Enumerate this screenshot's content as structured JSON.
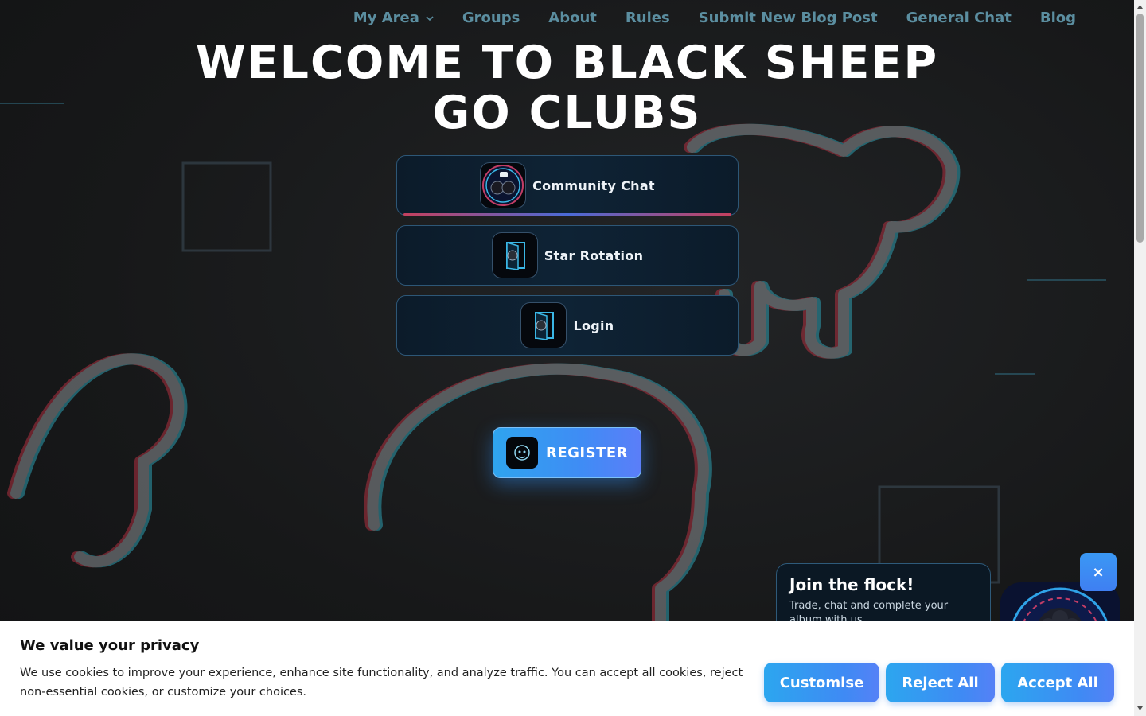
{
  "nav": {
    "items": [
      {
        "label": "My Area",
        "dropdown": true
      },
      {
        "label": "Groups"
      },
      {
        "label": "About"
      },
      {
        "label": "Rules"
      },
      {
        "label": "Submit New Blog Post"
      },
      {
        "label": "General Chat"
      },
      {
        "label": "Blog"
      }
    ]
  },
  "hero": {
    "title_line1": "WELCOME TO BLACK SHEEP",
    "title_line2": "GO CLUBS"
  },
  "actions": [
    {
      "label": "Community Chat",
      "icon": "chat-sheep-icon"
    },
    {
      "label": "Star Rotation",
      "icon": "door-sheep-icon"
    },
    {
      "label": "Login",
      "icon": "door-sheep-icon"
    }
  ],
  "register": {
    "label": "REGISTER",
    "icon": "sheep-icon"
  },
  "promo": {
    "title": "Join the flock!",
    "text": "Trade, chat and complete your album with us.",
    "close": "×"
  },
  "cookie": {
    "title": "We value your privacy",
    "text": "We use cookies to improve your experience, enhance site functionality, and analyze traffic. You can accept all cookies, reject non-essential cookies, or customize your choices.",
    "customise": "Customise",
    "reject": "Reject All",
    "accept": "Accept All"
  },
  "colors": {
    "nav": "#5b8ea0",
    "accent": "#3f8cf5",
    "background": "#161718"
  }
}
